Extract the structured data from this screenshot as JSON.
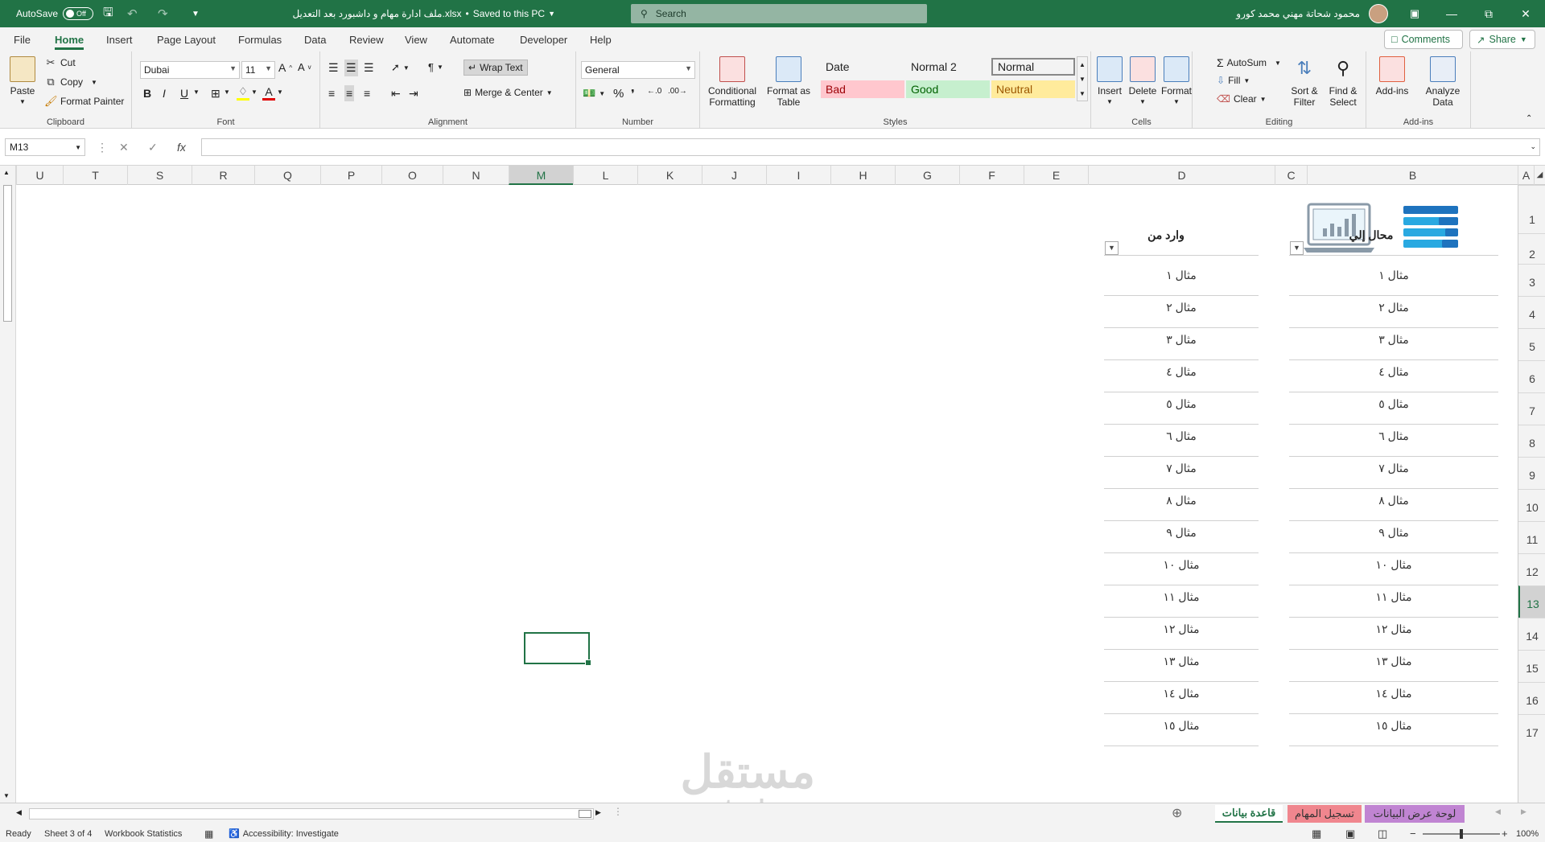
{
  "titlebar": {
    "autosave_label": "AutoSave",
    "autosave_state": "Off",
    "doc_title": "ملف ادارة مهام و داشبورد بعد التعديل.xlsx",
    "save_status": "Saved to this PC",
    "search_placeholder": "Search",
    "user_name": "محمود شحاتة مهني محمد كورو"
  },
  "menu": {
    "tabs": [
      "File",
      "Home",
      "Insert",
      "Page Layout",
      "Formulas",
      "Data",
      "Review",
      "View",
      "Automate",
      "Developer",
      "Help"
    ],
    "active_tab": "Home",
    "comments_label": "Comments",
    "share_label": "Share"
  },
  "ribbon": {
    "clipboard": {
      "label": "Clipboard",
      "paste": "Paste",
      "cut": "Cut",
      "copy": "Copy",
      "format_painter": "Format Painter"
    },
    "font": {
      "label": "Font",
      "font_name": "Dubai",
      "font_size": "11"
    },
    "alignment": {
      "label": "Alignment",
      "wrap_text": "Wrap Text",
      "merge_center": "Merge & Center"
    },
    "number": {
      "label": "Number",
      "format": "General"
    },
    "styles": {
      "label": "Styles",
      "conditional": "Conditional Formatting",
      "format_table": "Format as Table",
      "cells": [
        {
          "name": "Date",
          "bg": "#ffffff",
          "fg": "#222222"
        },
        {
          "name": "Normal 2",
          "bg": "#ffffff",
          "fg": "#222222"
        },
        {
          "name": "Normal",
          "bg": "#ffffff",
          "fg": "#222222"
        },
        {
          "name": "Bad",
          "bg": "#ffc7ce",
          "fg": "#9c0006"
        },
        {
          "name": "Good",
          "bg": "#c6efce",
          "fg": "#006100"
        },
        {
          "name": "Neutral",
          "bg": "#ffeb9c",
          "fg": "#9c5700"
        }
      ]
    },
    "cells": {
      "label": "Cells",
      "insert": "Insert",
      "delete": "Delete",
      "format": "Format"
    },
    "editing": {
      "label": "Editing",
      "autosum": "AutoSum",
      "fill": "Fill",
      "clear": "Clear",
      "sort_filter": "Sort & Filter",
      "find_select": "Find & Select"
    },
    "addins": {
      "label": "Add-ins",
      "addins": "Add-ins",
      "analyze": "Analyze Data"
    }
  },
  "formula_bar": {
    "name_box": "M13",
    "fx": "fx",
    "formula": ""
  },
  "columns": [
    "U",
    "T",
    "S",
    "R",
    "Q",
    "P",
    "O",
    "N",
    "M",
    "L",
    "K",
    "J",
    "I",
    "H",
    "G",
    "F",
    "E",
    "D",
    "C",
    "B",
    "A"
  ],
  "active_column": "M",
  "rows": [
    "1",
    "2",
    "3",
    "4",
    "5",
    "6",
    "7",
    "8",
    "9",
    "10",
    "11",
    "12",
    "13",
    "14",
    "15",
    "16",
    "17"
  ],
  "active_row": "13",
  "table": {
    "col_b_header": "محال إلي",
    "col_d_header": "وارد من",
    "col_b_values": [
      "مثال ١",
      "مثال ٢",
      "مثال ٣",
      "مثال ٤",
      "مثال ٥",
      "مثال ٦",
      "مثال ٧",
      "مثال ٨",
      "مثال ٩",
      "مثال ١٠",
      "مثال ١١",
      "مثال ١٢",
      "مثال ١٣",
      "مثال ١٤",
      "مثال ١٥"
    ],
    "col_d_values": [
      "مثال ١",
      "مثال ٢",
      "مثال ٣",
      "مثال ٤",
      "مثال ٥",
      "مثال ٦",
      "مثال ٧",
      "مثال ٨",
      "مثال ٩",
      "مثال ١٠",
      "مثال ١١",
      "مثال ١٢",
      "مثال ١٣",
      "مثال ١٤",
      "مثال ١٥"
    ]
  },
  "sheets": [
    {
      "name": "لوحة عرض البيانات",
      "color": "#c084d2"
    },
    {
      "name": "تسجيل المهام",
      "color": "#f0868e"
    },
    {
      "name": "قاعدة بيانات",
      "color": "#ffffff"
    }
  ],
  "active_sheet": "قاعدة بيانات",
  "status": {
    "ready": "Ready",
    "sheet_info": "Sheet 3 of 4",
    "workbook_stats": "Workbook Statistics",
    "accessibility": "Accessibility: Investigate",
    "zoom": "100%"
  },
  "watermark": {
    "text_ar": "مستقل",
    "text_en": "mostaql.com"
  }
}
